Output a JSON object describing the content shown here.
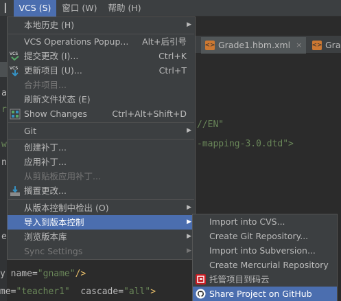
{
  "menubar": {
    "vcs": "VCS (S)",
    "window": "窗口 (W)",
    "help": "帮助 (H)"
  },
  "tabs": [
    {
      "label": "Grade1.hbm.xml",
      "close": "×"
    },
    {
      "label": "Grade"
    }
  ],
  "code": {
    "line_en": "//EN\"",
    "line_dtd": "-mapping-3.0.dtd\">",
    "line_w": "w",
    "line_gname_key": "y name=",
    "line_gname_val": "\"gname\"",
    "line_gname_end": "/>",
    "line_teacher_key": "me=",
    "line_teacher_val": "\"teacher1\"",
    "line_cascade_key": "cascade=",
    "line_cascade_val": "\"all\"",
    "line_cascade_end": ">"
  },
  "vcs_menu": {
    "items": [
      {
        "label": "本地历史 (H)",
        "shortcut": "",
        "submenu": true,
        "disabled": false
      },
      {
        "label": "VCS Operations Popup...",
        "shortcut": "Alt+后引号",
        "submenu": false,
        "disabled": false
      },
      {
        "label": "提交更改 (I)...",
        "shortcut": "Ctrl+K",
        "submenu": false,
        "disabled": false
      },
      {
        "label": "更新项目 (U)...",
        "shortcut": "Ctrl+T",
        "submenu": false,
        "disabled": false
      },
      {
        "label": "合并项目...",
        "shortcut": "",
        "submenu": false,
        "disabled": true
      },
      {
        "label": "刷新文件状态 (E)",
        "shortcut": "",
        "submenu": false,
        "disabled": false
      },
      {
        "label": "Show Changes",
        "shortcut": "Ctrl+Alt+Shift+D",
        "submenu": false,
        "disabled": false
      },
      {
        "label": "Git",
        "shortcut": "",
        "submenu": true,
        "disabled": false
      },
      {
        "label": "创建补丁...",
        "shortcut": "",
        "submenu": false,
        "disabled": false
      },
      {
        "label": "应用补丁...",
        "shortcut": "",
        "submenu": false,
        "disabled": false
      },
      {
        "label": "从剪贴板应用补丁...",
        "shortcut": "",
        "submenu": false,
        "disabled": true
      },
      {
        "label": "搁置更改...",
        "shortcut": "",
        "submenu": false,
        "disabled": false
      },
      {
        "label": "从版本控制中检出 (O)",
        "shortcut": "",
        "submenu": true,
        "disabled": false
      },
      {
        "label": "导入到版本控制",
        "shortcut": "",
        "submenu": true,
        "disabled": false
      },
      {
        "label": "浏览版本库",
        "shortcut": "",
        "submenu": true,
        "disabled": false
      },
      {
        "label": "Sync Settings",
        "shortcut": "",
        "submenu": true,
        "disabled": true
      }
    ],
    "icon_text": "VCS"
  },
  "import_submenu": {
    "items": [
      {
        "label": "Import into CVS..."
      },
      {
        "label": "Create Git Repository..."
      },
      {
        "label": "Import into Subversion..."
      },
      {
        "label": "Create Mercurial Repository"
      },
      {
        "label": "托管项目到码云"
      },
      {
        "label": "Share Project on GitHub"
      }
    ]
  },
  "colors": {
    "menu_bg": "#3c3f41",
    "selection": "#4b6eaf",
    "editor_bg": "#2b2b2b",
    "string": "#6a8759"
  }
}
